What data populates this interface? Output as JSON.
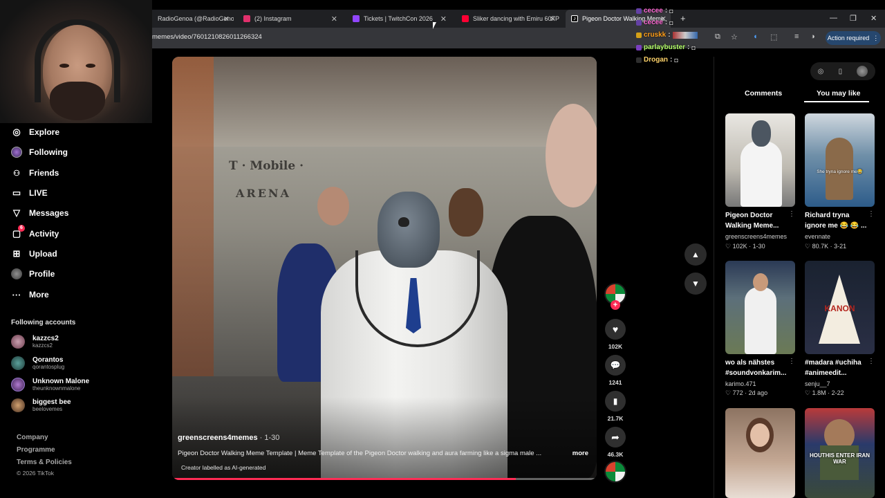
{
  "browser": {
    "tabs": [
      {
        "title": "RadioGenoa (@RadioGenoa",
        "favicon_color": "#1d9bf0"
      },
      {
        "title": "(2) Instagram",
        "favicon_color": "#e1306c"
      },
      {
        "title": "Tickets | TwitchCon 2026",
        "favicon_color": "#9146ff"
      },
      {
        "title": "Sliker dancing with Emiru 60FP",
        "favicon_color": "#ff0033"
      },
      {
        "title": "Pigeon Doctor Walking Meme",
        "favicon_color": "#ffffff"
      }
    ],
    "new_tab": "+",
    "url": "memes/video/7601210826011266324",
    "action_required": "Action required"
  },
  "chat": [
    {
      "user": "cecee",
      "color": "#ff6ad5"
    },
    {
      "user": "cecee",
      "color": "#ff6ad5"
    },
    {
      "user": "cruskk",
      "color": "#ff9f1a"
    },
    {
      "user": "parlaybuster",
      "color": "#b5ff6a"
    },
    {
      "user": "Drogan",
      "color": "#ffd36a"
    }
  ],
  "sidebar": {
    "nav": [
      {
        "label": "Explore",
        "icon": "compass-icon",
        "glyph": "◎"
      },
      {
        "label": "Following",
        "icon": "following-avatar-icon",
        "glyph": ""
      },
      {
        "label": "Friends",
        "icon": "friends-icon",
        "glyph": "👥"
      },
      {
        "label": "LIVE",
        "icon": "live-icon",
        "glyph": "▭"
      },
      {
        "label": "Messages",
        "icon": "messages-icon",
        "glyph": "▽"
      },
      {
        "label": "Activity",
        "icon": "activity-icon",
        "glyph": "▢",
        "badge": "6"
      },
      {
        "label": "Upload",
        "icon": "upload-icon",
        "glyph": "⊞"
      },
      {
        "label": "Profile",
        "icon": "profile-avatar-icon",
        "glyph": ""
      },
      {
        "label": "More",
        "icon": "more-icon",
        "glyph": "···"
      }
    ],
    "following_title": "Following accounts",
    "following": [
      {
        "name": "kazzcs2",
        "handle": "kazzcs2",
        "avatar_color": "#8a5a6a"
      },
      {
        "name": "Qorantos",
        "handle": "qorantosplug",
        "avatar_color": "#3d6e6a"
      },
      {
        "name": "Unknown Malone",
        "handle": "theunknownmalone",
        "avatar_color": "#7a4d8a"
      },
      {
        "name": "biggest bee",
        "handle": "beelovemes",
        "avatar_color": "#6b5a4a"
      }
    ],
    "footer": [
      "Company",
      "Programme",
      "Terms & Policies",
      "© 2026 TikTok"
    ]
  },
  "video": {
    "creator": "greenscreens4memes",
    "date": " · 1-30",
    "caption": "Pigeon Doctor Walking Meme Template | Meme Template of the Pigeon Doctor walking and aura farming like a sigma male ...",
    "more": "more",
    "ai_label": "Creator labelled as AI-generated",
    "wall_brand": "T · Mobile ·",
    "wall_arena": "ARENA",
    "progress": 0.81
  },
  "actions": {
    "likes": "102K",
    "comments": "1241",
    "saves": "21.7K",
    "shares": "46.3K"
  },
  "right_panel": {
    "tabs": [
      "Comments",
      "You may like"
    ],
    "cards": [
      {
        "title": "Pigeon Doctor Walking Meme...",
        "author": "greenscreens4memes",
        "stats": "♡ 102K · 1-30",
        "thumb": "pigeon-doctor",
        "overlay": ""
      },
      {
        "title": "Richard tryna ignore me 😂 😂 ...",
        "author": "evennate",
        "stats": "♡ 80.7K · 3-21",
        "thumb": "store",
        "overlay": "She tryna ignore me😂"
      },
      {
        "title": "wo als nähstes #soundvonkarim...",
        "author": "karimo.471",
        "stats": "♡ 772 · 2d ago",
        "thumb": "street",
        "overlay": ""
      },
      {
        "title": "#madara #uchiha #animeedit...",
        "author": "senju__7",
        "stats": "♡ 1.8M · 2-22",
        "thumb": "anime",
        "overlay": "KANON"
      },
      {
        "title": "",
        "author": "",
        "stats": "",
        "thumb": "woman",
        "overlay": ""
      },
      {
        "title": "",
        "author": "",
        "stats": "",
        "thumb": "news",
        "overlay": "HOUTHIS ENTER IRAN WAR"
      }
    ]
  }
}
